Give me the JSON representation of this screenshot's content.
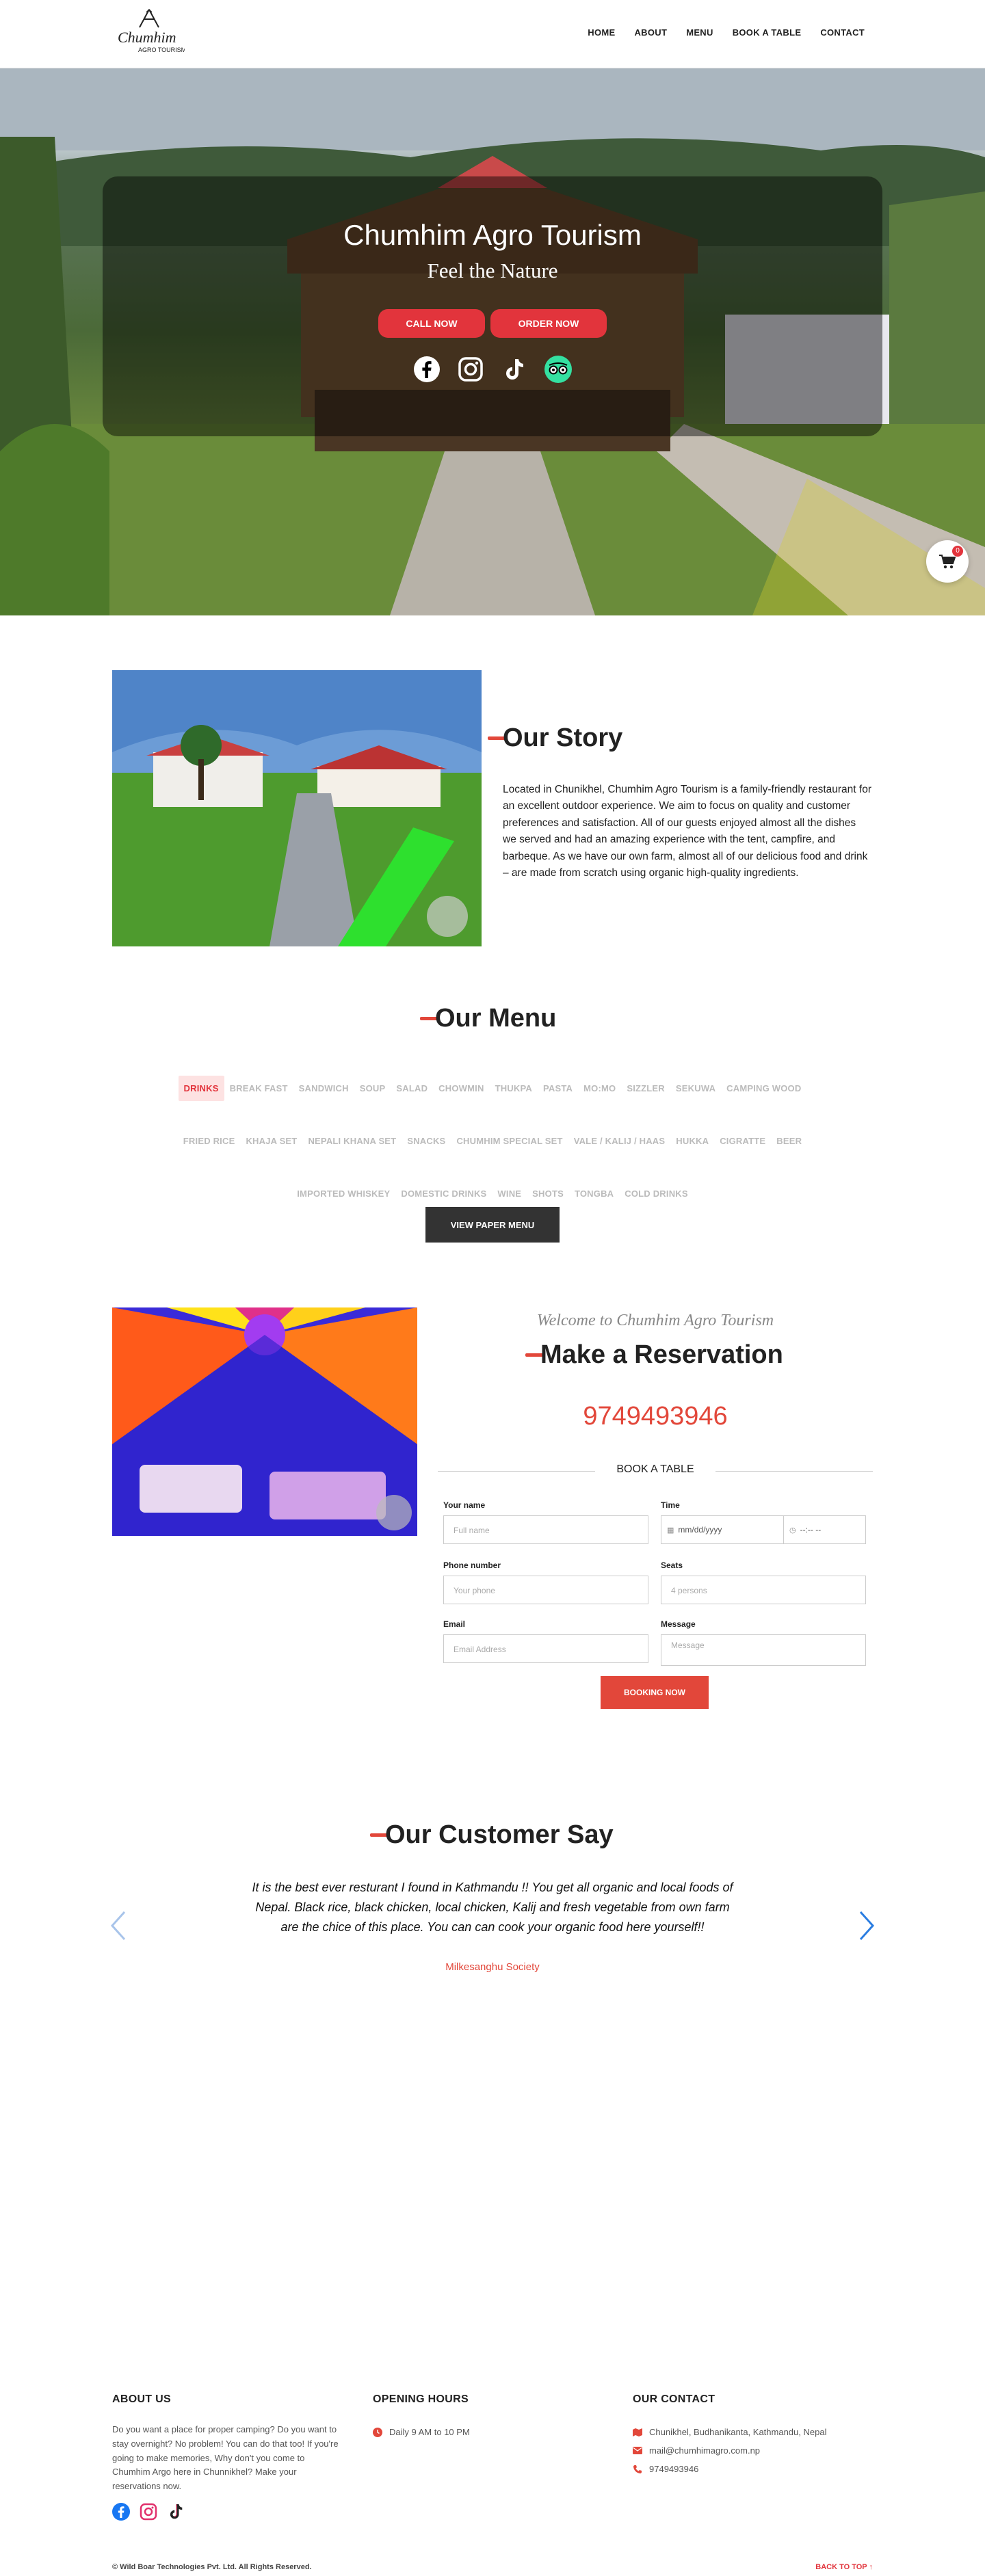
{
  "brand": {
    "logo_text": "Chumhim",
    "logo_sub": "AGRO TOURISM"
  },
  "nav": {
    "items": [
      "HOME",
      "ABOUT",
      "MENU",
      "BOOK A TABLE",
      "CONTACT"
    ]
  },
  "hero": {
    "title": "Chumhim Agro Tourism",
    "subtitle": "Feel the Nature",
    "call_btn": "CALL NOW",
    "order_btn": "ORDER NOW",
    "social_icons": [
      "facebook-icon",
      "instagram-icon",
      "tiktok-icon",
      "tripadvisor-icon"
    ]
  },
  "cart": {
    "count": "0"
  },
  "story": {
    "title": "Our Story",
    "text": "Located in Chunikhel, Chumhim Agro Tourism is a family-friendly restaurant for an excellent outdoor experience. We aim to focus on quality and customer preferences and satisfaction. All of our guests enjoyed almost all the dishes we served and had an amazing experience with the tent, campfire, and barbeque. As we have our own farm, almost all of our delicious food and drink – are made from scratch using organic high-quality ingredients."
  },
  "menu": {
    "title": "Our Menu",
    "categories": [
      "DRINKS",
      "BREAK FAST",
      "SANDWICH",
      "SOUP",
      "SALAD",
      "CHOWMIN",
      "THUKPA",
      "PASTA",
      "MO:MO",
      "SIZZLER",
      "SEKUWA",
      "CAMPING WOOD",
      "FRIED RICE",
      "KHAJA SET",
      "NEPALI KHANA SET",
      "SNACKS",
      "CHUMHIM SPECIAL SET",
      "VALE / KALIJ / HAAS",
      "HUKKA",
      "CIGRATTE",
      "BEER",
      "IMPORTED WHISKEY",
      "DOMESTIC DRINKS",
      "WINE",
      "SHOTS",
      "TONGBA",
      "COLD DRINKS"
    ],
    "active": "DRINKS",
    "paper_btn": "VIEW PAPER MENU"
  },
  "reservation": {
    "welcome": "Welcome to Chumhim Agro Tourism",
    "title": "Make a Reservation",
    "phone": "9749493946",
    "book_label": "BOOK A TABLE",
    "fields": {
      "name_label": "Your name",
      "name_placeholder": "Full name",
      "time_label": "Time",
      "date_placeholder": "mm/dd/yyyy",
      "time_placeholder": "--:-- --",
      "phone_label": "Phone number",
      "phone_placeholder": "Your phone",
      "seats_label": "Seats",
      "seats_placeholder": "4 persons",
      "email_label": "Email",
      "email_placeholder": "Email Address",
      "message_label": "Message",
      "message_placeholder": "Message"
    },
    "submit": "BOOKING NOW"
  },
  "testimonials": {
    "title": "Our Customer Say",
    "quote": "It is the best ever resturant I found in Kathmandu !! You get all organic and local foods of Nepal. Black rice, black chicken, local chicken, Kalij and fresh vegetable from own farm are the chice of this place. You can can cook your organic food here yourself!!",
    "author": "Milkesanghu Society"
  },
  "footer": {
    "about_title": "ABOUT US",
    "about_text": "Do you want a place for proper camping? Do you want to stay overnight? No problem! You can do that too! If you're going to make memories, Why don't you come to Chumhim Argo here in Chunnikhel? Make your reservations now.",
    "hours_title": "OPENING HOURS",
    "hours": "Daily 9 AM to 10 PM",
    "contact_title": "OUR CONTACT",
    "address": "Chunikhel, Budhanikanta, Kathmandu, Nepal",
    "email": "mail@chumhimagro.com.np",
    "phone": "9749493946",
    "copyright": "© Wild Boar Technologies Pvt. Ltd. All Rights Reserved.",
    "back_to_top": "BACK TO TOP ↑"
  },
  "colors": {
    "accent": "#e2473a",
    "red_btn": "#e2343c",
    "dark_btn": "#333333"
  }
}
